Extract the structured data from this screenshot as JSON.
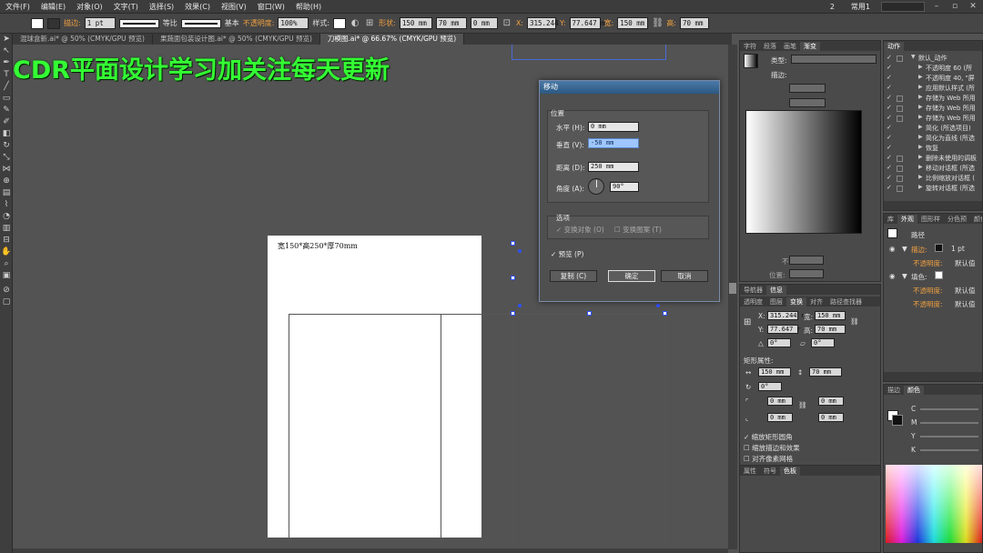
{
  "menu": [
    "文件(F)",
    "编辑(E)",
    "对象(O)",
    "文字(T)",
    "选择(S)",
    "效果(C)",
    "视图(V)",
    "窗口(W)",
    "帮助(H)"
  ],
  "menu_right": {
    "notif": "2",
    "workspace": "常用1"
  },
  "control": {
    "stroke_label": "描边:",
    "stroke_value": "1 pt",
    "stroke_style": "等比",
    "stroke_profile": "基本",
    "opacity_label": "不透明度:",
    "opacity_value": "100%",
    "style_label": "样式:",
    "shape_label": "形状:",
    "width1": "150 mm",
    "height1": "70 mm",
    "corner": "0 mm",
    "x_label": "X:",
    "x_value": "315.244",
    "y_label": "Y:",
    "y_value": "77.647 m",
    "w_label": "宽:",
    "w_value": "150 mm",
    "h_label": "高:",
    "h_value": "70 mm"
  },
  "tabs": [
    {
      "label": "混球盒新.ai* @ 50% (CMYK/GPU 预览)"
    },
    {
      "label": "果蔬面包装设计图.ai* @ 50% (CMYK/GPU 预览)"
    },
    {
      "label": "刀模图.ai* @ 66.67% (CMYK/GPU 预览)"
    }
  ],
  "watermark": "CDR平面设计学习加关注每天更新",
  "artboard_note": "宽150*高250*厚70mm",
  "dialog": {
    "title": "移动",
    "position_group": "位置",
    "horizontal_label": "水平 (H):",
    "horizontal_value": "0 mm",
    "vertical_label": "垂直 (V):",
    "vertical_value": "-50 mm",
    "distance_label": "距离 (D):",
    "distance_value": "250 mm",
    "angle_label": "角度 (A):",
    "angle_value": "90°",
    "options_group": "选项",
    "transform_objects": "变换对象 (O)",
    "transform_patterns": "变换图案 (T)",
    "preview": "预览 (P)",
    "copy_button": "复制 (C)",
    "ok_button": "确定",
    "cancel_button": "取消"
  },
  "swatch_panel": {
    "tabs": [
      "字符",
      "段落",
      "画笔",
      "渐变"
    ],
    "type_label": "类型:",
    "stroke_label": "描边:",
    "opacity_label": "不透明度:",
    "position_label": "位置:"
  },
  "transform_panel": {
    "tabs_top": [
      "导航器",
      "信息"
    ],
    "tabs": [
      "透明度",
      "图层",
      "变换",
      "对齐",
      "路径查找器"
    ],
    "x_label": "X:",
    "x_value": "315.244 r",
    "w_label": "宽:",
    "w_value": "150 mm",
    "y_label": "Y:",
    "y_value": "77.647 r",
    "h_label": "高:",
    "h_value": "70 mm",
    "rot_value": "0°",
    "shear_value": "0°",
    "rect_props": "矩形属性:",
    "rect_w": "150 mm",
    "rect_h": "70 mm",
    "rect_rot": "0°",
    "r1": "0 mm",
    "r2": "0 mm",
    "r3": "0 mm",
    "r4": "0 mm",
    "scale_corners": "缩放矩形圆角",
    "scale_strokes": "缩放描边和效果",
    "align_pixel": "对齐像素网格",
    "bottom_tabs": [
      "属性",
      "符号",
      "色板"
    ]
  },
  "actions_panel": {
    "tab": "动作",
    "set": "默认_动作",
    "items": [
      "不透明度 60 (所",
      "不透明度 40, \"屏",
      "应用默认样式 (所",
      "存储为 Web 所用",
      "存储为 Web 所用",
      "存储为 Web 所用",
      "简化 (所选项目)",
      "简化为直线 (所选",
      "恢复",
      "删除未使用的调板",
      "移动对话框 (所选",
      "比例缩放对话框 (",
      "旋转对话框 (所选"
    ]
  },
  "appearance_panel": {
    "tabs": [
      "库",
      "外观",
      "图形样",
      "分色预",
      "颜色"
    ],
    "path_label": "路径",
    "stroke_label": "描边:",
    "stroke_value": "1 pt",
    "opacity1_label": "不透明度:",
    "opacity1_value": "默认值",
    "fill_label": "填色:",
    "opacity2_label": "不透明度:",
    "opacity2_value": "默认值",
    "opacity3_label": "不透明度:",
    "opacity3_value": "默认值"
  },
  "color_panel": {
    "tabs": [
      "描边",
      "颜色"
    ],
    "channels": [
      "C",
      "M",
      "Y",
      "K"
    ]
  }
}
